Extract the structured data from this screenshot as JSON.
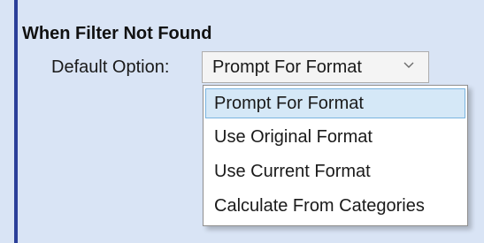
{
  "section": {
    "title": "When Filter Not Found"
  },
  "field": {
    "label": "Default Option:",
    "selected_value": "Prompt For Format"
  },
  "dropdown": {
    "options": [
      {
        "label": "Prompt For Format",
        "highlighted": true
      },
      {
        "label": "Use Original Format",
        "highlighted": false
      },
      {
        "label": "Use Current Format",
        "highlighted": false
      },
      {
        "label": "Calculate From Categories",
        "highlighted": false
      }
    ]
  },
  "icons": {
    "select_arrow": "chevron-down-icon"
  },
  "colors": {
    "background": "#d9e4f5",
    "accent_bar": "#2b3f99",
    "highlight_fill": "#d5e8f7",
    "highlight_border": "#79b4e0"
  }
}
